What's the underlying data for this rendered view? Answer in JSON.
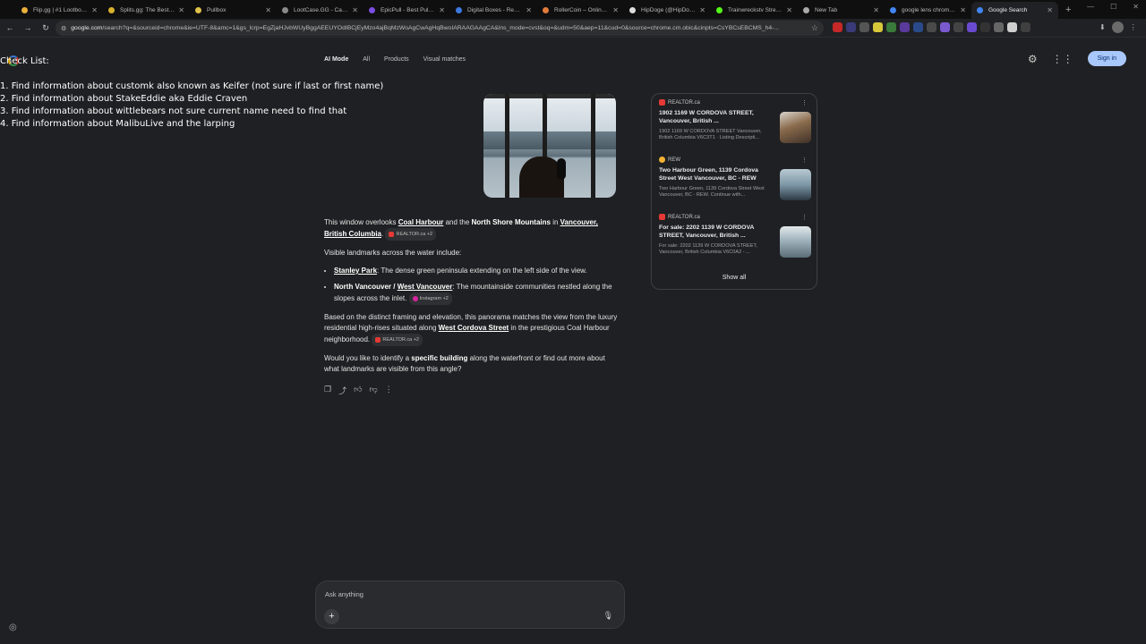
{
  "tabs": [
    {
      "title": "Flip.gg | #1 Lootbox P",
      "color": "#e8b03c"
    },
    {
      "title": "Splits.gg: The Best Ru",
      "color": "#d8b22c"
    },
    {
      "title": "Pullbox",
      "color": "#e0c24a"
    },
    {
      "title": "LootCase.GG - Cards",
      "color": "#8a8a8a"
    },
    {
      "title": "EpicPull - Best Pulls &",
      "color": "#7b4de0"
    },
    {
      "title": "Digital Boxes - Real Cr",
      "color": "#3c7ae0"
    },
    {
      "title": "RollerCoin – Online Bi",
      "color": "#e07b3c"
    },
    {
      "title": "HipDoge (@HipDoge)",
      "color": "#dddddd"
    },
    {
      "title": "Trainwreckstv Stream",
      "color": "#53fc18"
    },
    {
      "title": "New Tab",
      "color": "#aaaaaa"
    },
    {
      "title": "google lens chrome s",
      "color": "#4285f4"
    },
    {
      "title": "Google Search",
      "color": "#4285f4"
    }
  ],
  "toolbar": {
    "url_host": "google.com",
    "url_rest": "/search?q=&sourceid=chrome&ie=UTF-8&amc=1&gs_lcrp=EgZjaHJvbWUyBggAEEUYOdIBCjEyMzo4ajBqMzWoAgCwAgHqBwoIARAAGAAgCA&lns_mode=cvst&oq=&udm=50&aep=11&cud=0&source=chrome.cm.obic&cinpts=CsYBCsEBCMS_h4-..."
  },
  "checklist": {
    "title": "Check List:",
    "items": [
      "1. Find information about customk also known as Keifer (not sure if last or first name)",
      "2. Find information about StakeEddie aka Eddie Craven",
      "3. Find information about wittlebears not sure current name need to find that",
      "4. Find information about MalibuLive and the larping"
    ]
  },
  "google_tabs": [
    "AI Mode",
    "All",
    "Products",
    "Visual matches"
  ],
  "header": {
    "sign_in": "Sign in"
  },
  "answer": {
    "p1_a": "This window overlooks ",
    "p1_l1": "Coal Harbour",
    "p1_b": " and the ",
    "p1_bold": "North Shore Mountains",
    "p1_c": " in ",
    "p1_l2": "Vancouver, British Columbia",
    "p1_d": ".",
    "src1": "REALTOR.ca +2",
    "p2": "Visible landmarks across the water include:",
    "li1_l": "Stanley Park",
    "li1_t": ": The dense green peninsula extending on the left side of the view.",
    "li2_b": "North Vancouver / ",
    "li2_l": "West Vancouver",
    "li2_t": ": The mountainside communities nestled along the slopes across the inlet.",
    "src2": "Instagram +2",
    "p3_a": "Based on the distinct framing and elevation, this panorama matches the view from the luxury residential high-rises situated along ",
    "p3_l": "West Cordova Street",
    "p3_b": " in the prestigious Coal Harbour neighborhood.",
    "src3": "REALTOR.ca +2",
    "p4_a": "Would you like to identify a ",
    "p4_bold": "specific building",
    "p4_b": " along the waterfront or find out more about what landmarks are visible from this angle?"
  },
  "sources": [
    {
      "site": "REALTOR.ca",
      "title": "1902 1169 W CORDOVA STREET, Vancouver, British ...",
      "snippet": "1902 1169 W CORDOVA STREET Vancouver, British Columbia V6C3T1 · Listing Descripti..."
    },
    {
      "site": "REW",
      "title": "Two Harbour Green, 1139 Cordova Street West Vancouver, BC - REW",
      "snippet": "Two Harbour Green, 1139 Cordova Street West Vancouver, BC - REW. Continue with..."
    },
    {
      "site": "REALTOR.ca",
      "title": "For sale: 2202 1139 W CORDOVA STREET, Vancouver, British ...",
      "snippet": "For sale: 2202 1139 W CORDOVA STREET, Vancouver, British Columbia V6C0A2 - ..."
    }
  ],
  "show_all": "Show all",
  "ask": {
    "placeholder": "Ask anything"
  }
}
